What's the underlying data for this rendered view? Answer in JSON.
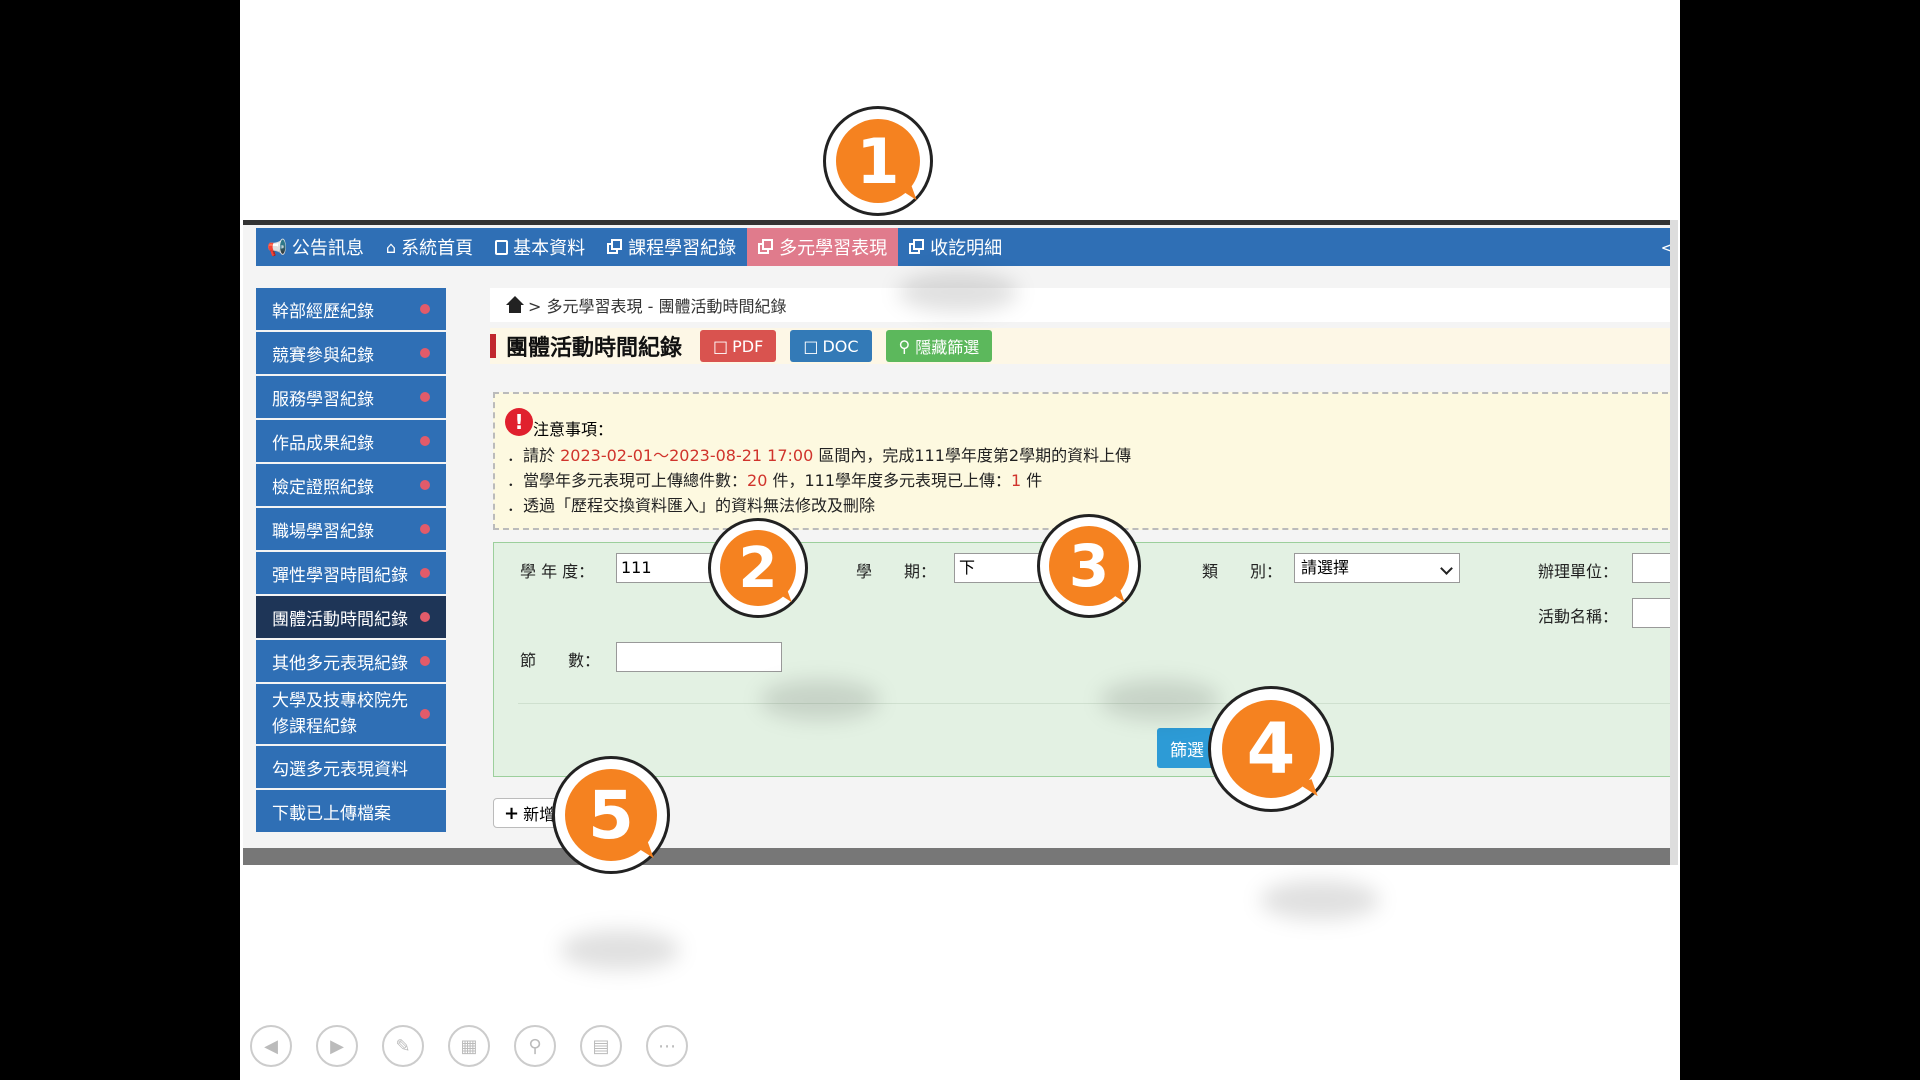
{
  "nav": {
    "items": [
      {
        "label": "公告訊息",
        "icon": "megaphone-icon"
      },
      {
        "label": "系統首頁",
        "icon": "home-icon"
      },
      {
        "label": "基本資料",
        "icon": "document-icon"
      },
      {
        "label": "課程學習紀錄",
        "icon": "copy-icon"
      },
      {
        "label": "多元學習表現",
        "icon": "copy-icon",
        "active": true
      },
      {
        "label": "收訖明細",
        "icon": "copy-icon"
      }
    ],
    "end_glyph": "<"
  },
  "sidebar": {
    "items": [
      {
        "label": "幹部經歷紀錄"
      },
      {
        "label": "競賽參與紀錄"
      },
      {
        "label": "服務學習紀錄"
      },
      {
        "label": "作品成果紀錄"
      },
      {
        "label": "檢定證照紀錄"
      },
      {
        "label": "職場學習紀錄"
      },
      {
        "label": "彈性學習時間紀錄"
      },
      {
        "label": "團體活動時間紀錄",
        "active": true
      },
      {
        "label": "其他多元表現紀錄"
      },
      {
        "label": "大學及技專校院先\n修課程紀錄"
      },
      {
        "label": "勾選多元表現資料"
      },
      {
        "label": "下載已上傳檔案"
      }
    ]
  },
  "breadcrumb": "> 多元學習表現 - 團體活動時間紀錄",
  "page": {
    "title": "團體活動時間紀錄",
    "pdf_label": "PDF",
    "doc_label": "DOC",
    "hide_filter_label": "隱藏篩選"
  },
  "notice": {
    "title": "注意事項：",
    "line1_prefix": "．請於",
    "line1_range": "2023-02-01～2023-08-21 17:00",
    "line1_suffix": "區間內，完成111學年度第2學期的資料上傳",
    "line2_prefix": "．當學年多元表現可上傳總件數：",
    "line2_total": "20",
    "line2_middle": "件，111學年度多元表現已上傳：",
    "line2_uploaded": "1",
    "line2_suffix": "件",
    "line3": "．透過「歷程交換資料匯入」的資料無法修改及刪除"
  },
  "filter": {
    "year_label": "學 年 度：",
    "year_value": "111",
    "semester_label": "學　　期：",
    "semester_value": "下",
    "category_label": "類　　別：",
    "category_value": "請選擇",
    "organizer_label": "辦理單位：",
    "activity_label": "活動名稱：",
    "sessions_label": "節　　數：",
    "submit_label": "篩選"
  },
  "add_button_label": "新增",
  "badges": [
    "1",
    "2",
    "3",
    "4",
    "5"
  ]
}
